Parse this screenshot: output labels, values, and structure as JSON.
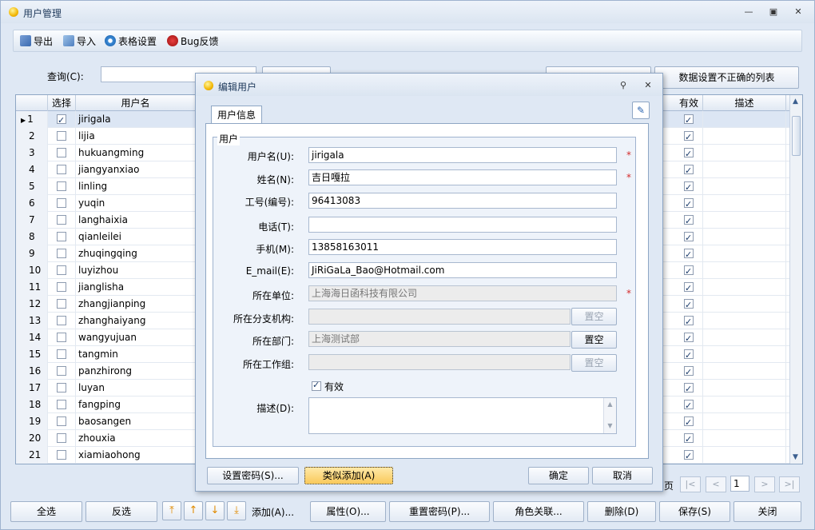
{
  "window": {
    "title": "用户管理",
    "min": "—",
    "max": "▣",
    "close": "✕"
  },
  "toolbar": {
    "export": "导出",
    "import": "导入",
    "table_settings": "表格设置",
    "bug": "Bug反馈"
  },
  "search": {
    "label": "查询(C):",
    "value": ""
  },
  "top_right_button": "数据设置不正确的列表",
  "grid": {
    "columns": {
      "select": "选择",
      "username": "用户名",
      "valid": "有效",
      "desc": "描述"
    },
    "rows": [
      {
        "no": "1",
        "username": "jirigala",
        "checked": true
      },
      {
        "no": "2",
        "username": "lijia",
        "checked": false
      },
      {
        "no": "3",
        "username": "hukuangming",
        "checked": false
      },
      {
        "no": "4",
        "username": "jiangyanxiao",
        "checked": false
      },
      {
        "no": "5",
        "username": "linling",
        "checked": false
      },
      {
        "no": "6",
        "username": "yuqin",
        "checked": false
      },
      {
        "no": "7",
        "username": "langhaixia",
        "checked": false
      },
      {
        "no": "8",
        "username": "qianleilei",
        "checked": false
      },
      {
        "no": "9",
        "username": "zhuqingqing",
        "checked": false
      },
      {
        "no": "10",
        "username": "luyizhou",
        "checked": false
      },
      {
        "no": "11",
        "username": "jianglisha",
        "checked": false
      },
      {
        "no": "12",
        "username": "zhangjianping",
        "checked": false
      },
      {
        "no": "13",
        "username": "zhanghaiyang",
        "checked": false
      },
      {
        "no": "14",
        "username": "wangyujuan",
        "checked": false
      },
      {
        "no": "15",
        "username": "tangmin",
        "checked": false
      },
      {
        "no": "16",
        "username": "panzhirong",
        "checked": false
      },
      {
        "no": "17",
        "username": "luyan",
        "checked": false
      },
      {
        "no": "18",
        "username": "fangping",
        "checked": false
      },
      {
        "no": "19",
        "username": "baosangen",
        "checked": false
      },
      {
        "no": "20",
        "username": "zhouxia",
        "checked": false
      },
      {
        "no": "21",
        "username": "xiamiaohong",
        "checked": false
      }
    ]
  },
  "pager": {
    "page_suffix": "页",
    "first": "|<",
    "prev": "<",
    "page": "1",
    "next": ">",
    "last": ">|"
  },
  "bottom": {
    "select_all": "全选",
    "invert": "反选",
    "add": "添加(A)...",
    "properties": "属性(O)...",
    "reset_password": "重置密码(P)...",
    "role_link": "角色关联...",
    "delete": "删除(D)",
    "save": "保存(S)",
    "close": "关闭"
  },
  "dialog": {
    "title": "编辑用户",
    "tab": "用户信息",
    "group": "用户",
    "fields": {
      "username_label": "用户名(U):",
      "username": "jirigala",
      "realname_label": "姓名(N):",
      "realname": "吉日嘎拉",
      "code_label": "工号(编号):",
      "code": "96413083",
      "phone_label": "电话(T):",
      "phone": "",
      "mobile_label": "手机(M):",
      "mobile": "13858163011",
      "email_label": "E_mail(E):",
      "email": "JiRiGaLa_Bao@Hotmail.com",
      "company_label": "所在单位:",
      "company": "上海海日函科技有限公司",
      "branch_label": "所在分支机构:",
      "branch": "",
      "dept_label": "所在部门:",
      "dept": "上海测试部",
      "workgroup_label": "所在工作组:",
      "workgroup": "",
      "valid_label": "有效",
      "desc_label": "描述(D):",
      "desc": ""
    },
    "clear": "置空",
    "required": "*",
    "set_password": "设置密码(S)...",
    "similar_add": "类似添加(A)",
    "ok": "确定",
    "cancel": "取消"
  }
}
